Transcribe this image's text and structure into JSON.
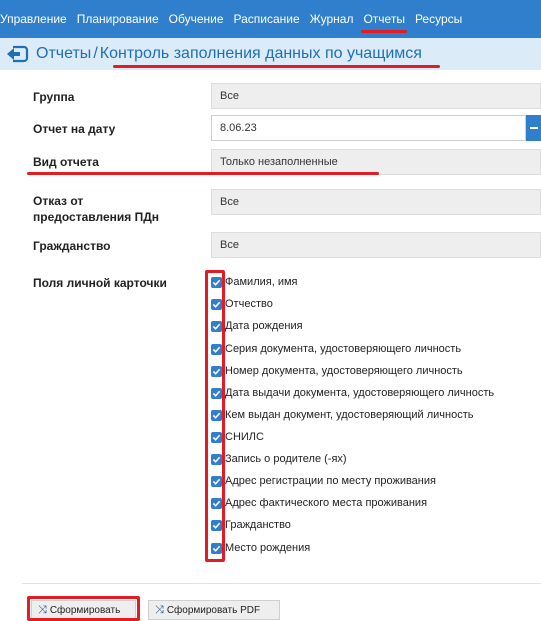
{
  "nav": {
    "items": [
      "Управление",
      "Планирование",
      "Обучение",
      "Расписание",
      "Журнал",
      "Отчеты",
      "Ресурсы"
    ],
    "active": "Отчеты"
  },
  "breadcrumb": {
    "parent": "Отчеты",
    "separator": "/",
    "current": "Контроль заполнения данных по учащимся"
  },
  "form": {
    "group_label": "Группа",
    "group_value": "Все",
    "date_label": "Отчет на дату",
    "date_value": "8.06.23",
    "report_type_label": "Вид отчета",
    "report_type_value": "Только незаполненные",
    "pdn_refusal_label": "Отказ от предоставления ПДн",
    "pdn_refusal_value": "Все",
    "citizenship_label": "Гражданство",
    "citizenship_value": "Все",
    "card_fields_label": "Поля личной карточки"
  },
  "card_fields": [
    {
      "label": "Фамилия, имя",
      "checked": true
    },
    {
      "label": "Отчество",
      "checked": true
    },
    {
      "label": "Дата рождения",
      "checked": true
    },
    {
      "label": "Серия документа, удостоверяющего личность",
      "checked": true
    },
    {
      "label": "Номер документа, удостоверяющего личность",
      "checked": true
    },
    {
      "label": "Дата выдачи документа, удостоверяющего личность",
      "checked": true
    },
    {
      "label": "Кем выдан документ, удостоверяющий личность",
      "checked": true
    },
    {
      "label": "СНИЛС",
      "checked": true
    },
    {
      "label": "Запись о родителе (-ях)",
      "checked": true
    },
    {
      "label": "Адрес регистрации по месту проживания",
      "checked": true
    },
    {
      "label": "Адрес фактического места проживания",
      "checked": true
    },
    {
      "label": "Гражданство",
      "checked": true
    },
    {
      "label": "Место рождения",
      "checked": true
    }
  ],
  "buttons": {
    "generate": "Сформировать",
    "generate_pdf": "Сформировать PDF"
  },
  "colors": {
    "nav_bg": "#2f7fcc",
    "header_bg": "#dcebf8",
    "accent_blue": "#1f6fb5",
    "highlight_red": "#e31b23"
  }
}
